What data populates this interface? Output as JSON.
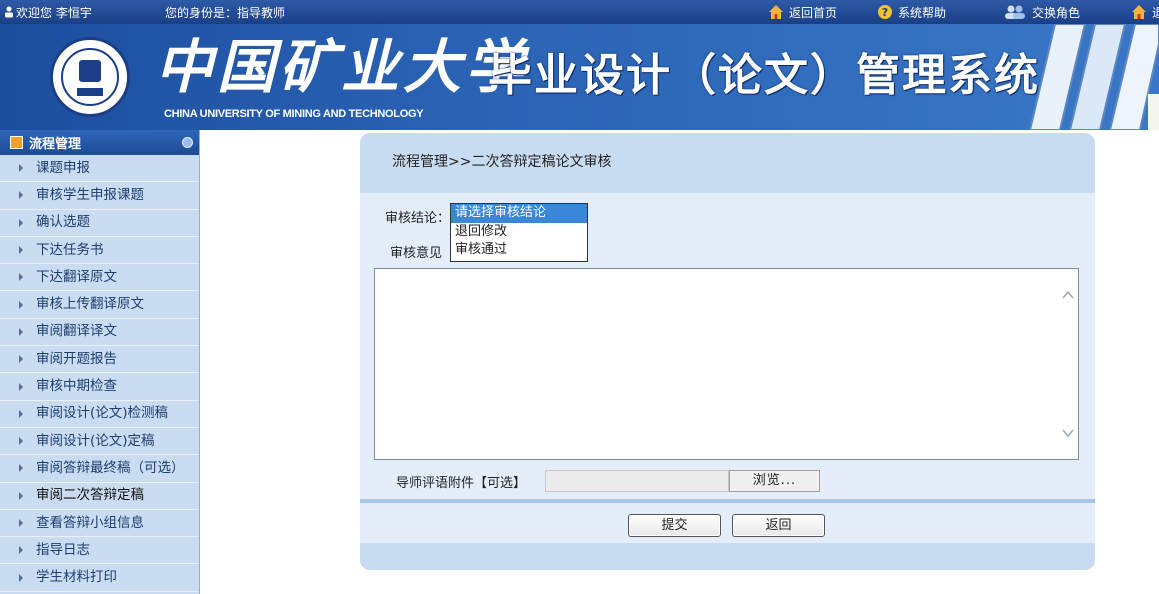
{
  "topbar": {
    "welcome": "欢迎您 李恒宇",
    "identity": "您的身份是：指导教师",
    "nav": [
      {
        "label": "返回首页",
        "icon": "home-icon"
      },
      {
        "label": "系统帮助",
        "icon": "help-icon"
      },
      {
        "label": "交换角色",
        "icon": "users-icon"
      },
      {
        "label": "退",
        "icon": "home-icon"
      }
    ]
  },
  "banner": {
    "university_cn": "中国矿业大学",
    "university_en": "CHINA UNIVERSITY OF MINING AND TECHNOLOGY",
    "system_title": "毕业设计（论文）管理系统"
  },
  "sidebar": {
    "header": "流程管理",
    "items": [
      {
        "label": "课题申报"
      },
      {
        "label": "审核学生申报课题"
      },
      {
        "label": "确认选题"
      },
      {
        "label": "下达任务书"
      },
      {
        "label": "下达翻译原文"
      },
      {
        "label": "审核上传翻译原文"
      },
      {
        "label": "审阅翻译译文"
      },
      {
        "label": "审阅开题报告"
      },
      {
        "label": "审核中期检查"
      },
      {
        "label": "审阅设计(论文)检测稿"
      },
      {
        "label": "审阅设计(论文)定稿"
      },
      {
        "label": "审阅答辩最终稿（可选）"
      },
      {
        "label": "审阅二次答辩定稿"
      },
      {
        "label": "查看答辩小组信息"
      },
      {
        "label": "指导日志"
      },
      {
        "label": "学生材料打印"
      }
    ]
  },
  "main": {
    "breadcrumb": "流程管理>>二次答辩定稿论文审核",
    "conclusion_label": "审核结论：",
    "conclusion_options": [
      "请选择审核结论",
      "退回修改",
      "审核通过"
    ],
    "opinion_label": "审核意见",
    "attachment_label": "导师评语附件【可选】",
    "browse_label": "浏览...",
    "submit_label": "提交",
    "back_label": "返回"
  }
}
